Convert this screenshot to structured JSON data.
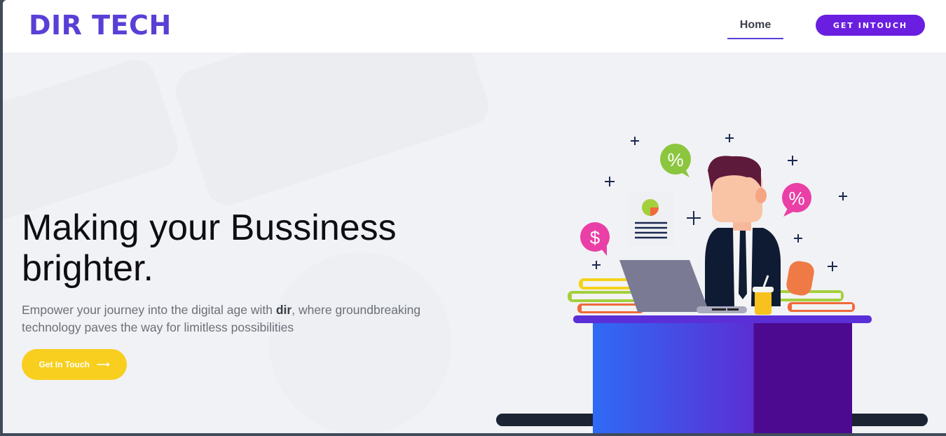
{
  "header": {
    "logo": "DIR TECH",
    "nav": {
      "home_label": "Home"
    },
    "cta_label": "GET INTOUCH"
  },
  "hero": {
    "title_line1": "Making your Bussiness",
    "title_line2": "brighter.",
    "subtitle_before": "Empower your journey into the digital age with ",
    "subtitle_bold": "dir",
    "subtitle_after": ", where groundbreaking technology paves the way for limitless possibilities",
    "button_label": "Get In Touch",
    "button_icon": "arrow-right-icon"
  },
  "illustration": {
    "percent_symbol": "%",
    "dollar_symbol": "$"
  },
  "colors": {
    "brand": "#5a3fd6",
    "cta_purple": "#6a1fe0",
    "cta_yellow": "#f8cf1f"
  }
}
